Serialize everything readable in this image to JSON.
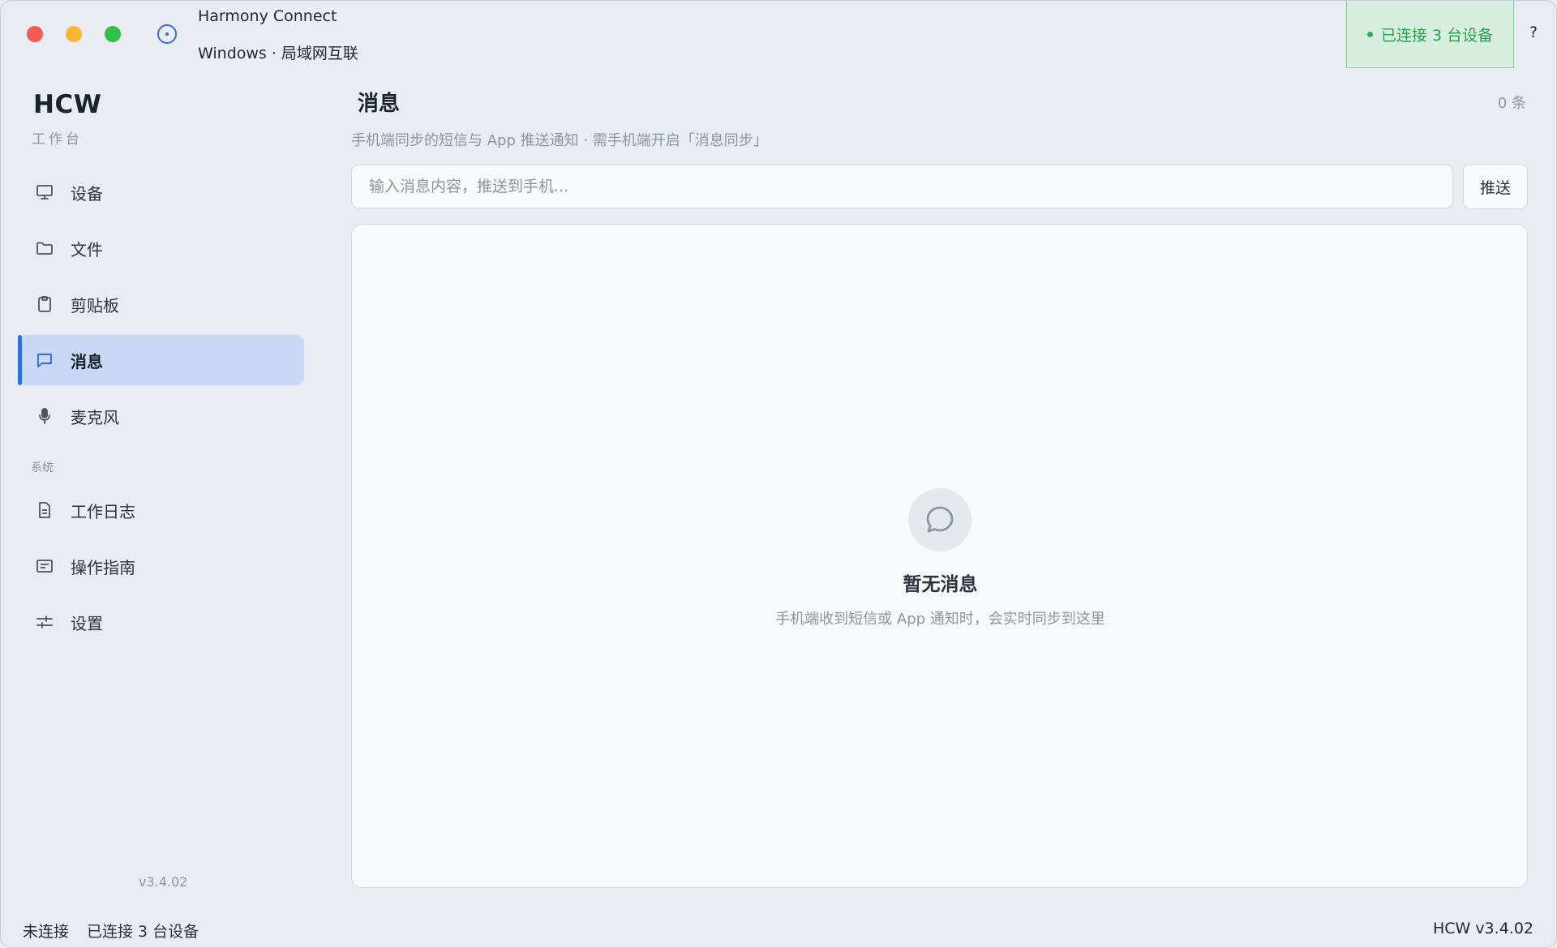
{
  "window": {
    "app_name": "Harmony Connect",
    "app_subtitle": "Windows · 局域网互联",
    "connection_badge": "已连接 3 台设备",
    "help_label": "?"
  },
  "sidebar": {
    "brand": "HCW",
    "brand_sub": "工作台",
    "items": [
      {
        "label": "设备",
        "icon": "monitor-icon"
      },
      {
        "label": "文件",
        "icon": "folder-icon"
      },
      {
        "label": "剪贴板",
        "icon": "clipboard-icon"
      },
      {
        "label": "消息",
        "icon": "message-icon",
        "active": true
      },
      {
        "label": "麦克风",
        "icon": "microphone-icon"
      }
    ],
    "system_section": "系统",
    "system_items": [
      {
        "label": "工作日志",
        "icon": "document-icon"
      },
      {
        "label": "操作指南",
        "icon": "guide-icon"
      },
      {
        "label": "设置",
        "icon": "sliders-icon"
      }
    ],
    "version": "v3.4.02"
  },
  "main": {
    "title": "消息",
    "count": "0 条",
    "description": "手机端同步的短信与 App 推送通知 · 需手机端开启「消息同步」",
    "input_placeholder": "输入消息内容，推送到手机...",
    "input_value": "",
    "send_label": "推送",
    "empty_title": "暂无消息",
    "empty_desc": "手机端收到短信或 App 通知时，会实时同步到这里"
  },
  "status_bar": {
    "connection": "未连接",
    "devices": "已连接 3 台设备",
    "app_version": "HCW v3.4.02"
  },
  "colors": {
    "accent": "#2f6fe0",
    "active_bg": "#c9d9f5",
    "success": "#27a04d",
    "success_bg": "#d8efe0"
  }
}
